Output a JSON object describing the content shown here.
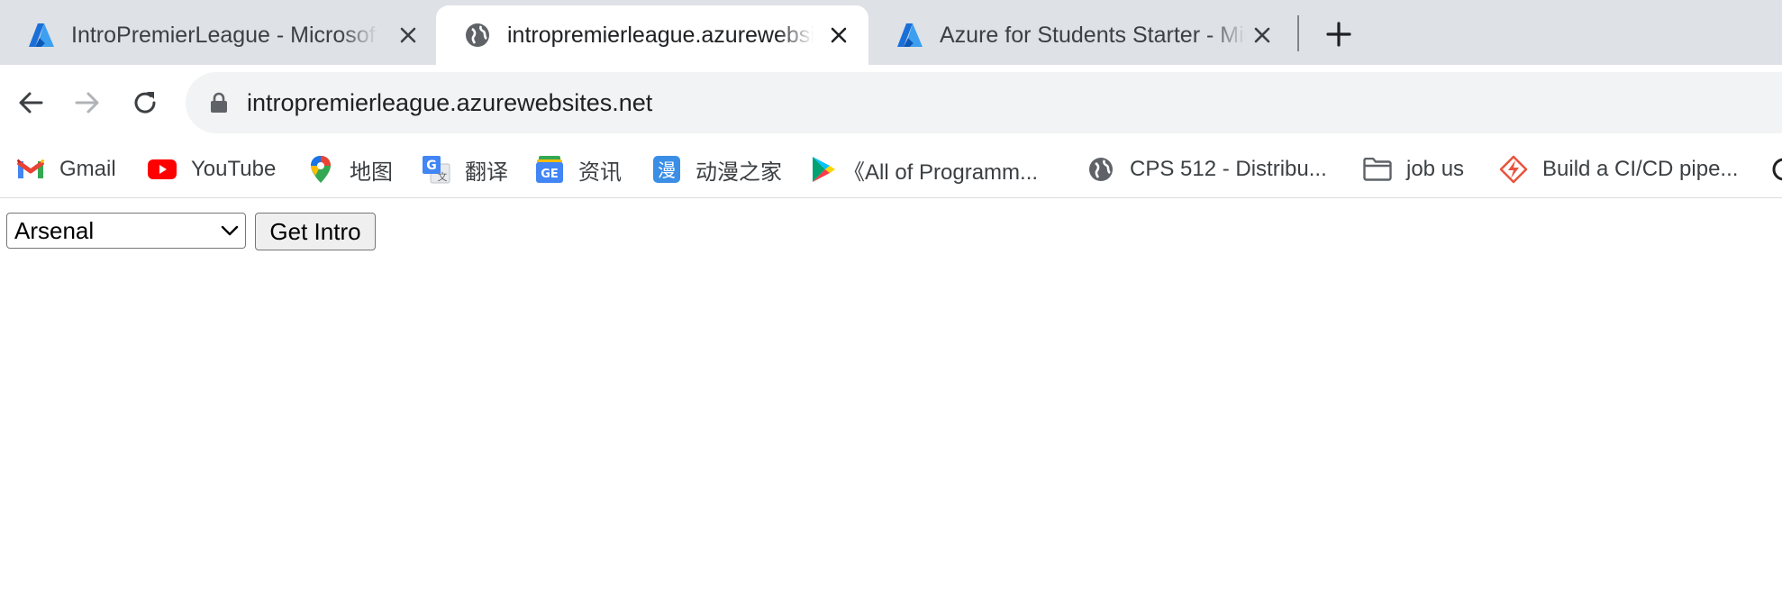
{
  "browser": {
    "tabs": [
      {
        "title": "IntroPremierLeague - Microsoft Azure",
        "icon": "azure-icon",
        "active": false
      },
      {
        "title": "intropremierleague.azurewebsites.net",
        "icon": "globe-icon",
        "active": true
      },
      {
        "title": "Azure for Students Starter - Microsoft Azure",
        "icon": "azure-icon",
        "active": false
      }
    ],
    "new_tab_icon": "plus-icon",
    "toolbar": {
      "back_icon": "arrow-left-icon",
      "forward_icon": "arrow-right-icon",
      "reload_icon": "reload-icon",
      "url": "intropremierleague.azurewebsites.net"
    },
    "bookmarks": [
      {
        "label": "Gmail",
        "icon": "gmail-icon"
      },
      {
        "label": "YouTube",
        "icon": "youtube-icon"
      },
      {
        "label": "地图",
        "icon": "maps-pin-icon"
      },
      {
        "label": "翻译",
        "icon": "translate-icon"
      },
      {
        "label": "资讯",
        "icon": "news-icon"
      },
      {
        "label": "动漫之家",
        "icon": "manga-icon"
      },
      {
        "label": "《All of Programm...",
        "icon": "play-store-icon"
      },
      {
        "label": "CPS 512 - Distribu...",
        "icon": "globe-icon"
      },
      {
        "label": "job us",
        "icon": "folder-icon"
      },
      {
        "label": "Build a CI/CD pipe...",
        "icon": "lightning-icon"
      }
    ]
  },
  "page": {
    "team_select": {
      "selected": "Arsenal"
    },
    "get_intro_label": "Get Intro"
  },
  "colors": {
    "tabstrip_bg": "#dee1e6",
    "omnibox_bg": "#f1f3f4",
    "azure_blue": "#0078d4",
    "youtube_red": "#ff0000"
  }
}
